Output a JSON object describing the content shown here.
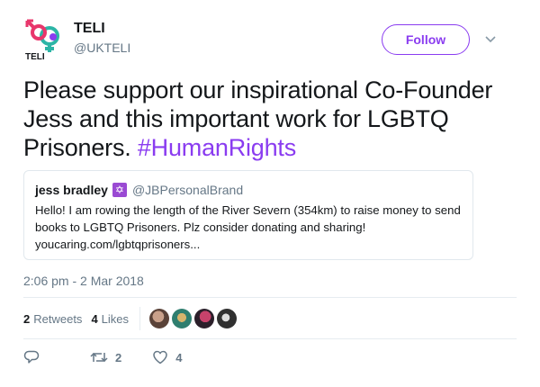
{
  "account": {
    "name": "TELI",
    "handle": "@UKTELI",
    "logo_text": "TELI",
    "follow_label": "Follow"
  },
  "tweet": {
    "text": "Please support our inspirational Co-Founder Jess and this important work for LGBTQ Prisoners. ",
    "hashtag": "#HumanRights"
  },
  "quoted_tweet": {
    "name": "jess bradley",
    "emoji_icon": "star-of-david-icon",
    "handle": "@JBPersonalBrand",
    "text": "Hello! I am rowing the length of the River Severn (354km) to raise money to send books to LGBTQ Prisoners. Plz consider donating and sharing!",
    "link": "youcaring.com/lgbtqprisoners..."
  },
  "timestamp": "2:06 pm - 2 Mar 2018",
  "stats": {
    "retweets_count": "2",
    "retweets_label": "Retweets",
    "likes_count": "4",
    "likes_label": "Likes"
  },
  "actions": {
    "reply_icon": "reply-icon",
    "retweet_icon": "retweet-icon",
    "retweet_count": "2",
    "like_icon": "heart-icon",
    "like_count": "4"
  },
  "colors": {
    "accent": "#8a3cf0",
    "secondary_text": "#657786",
    "primary_text": "#14171a",
    "border": "#e1e8ed"
  }
}
